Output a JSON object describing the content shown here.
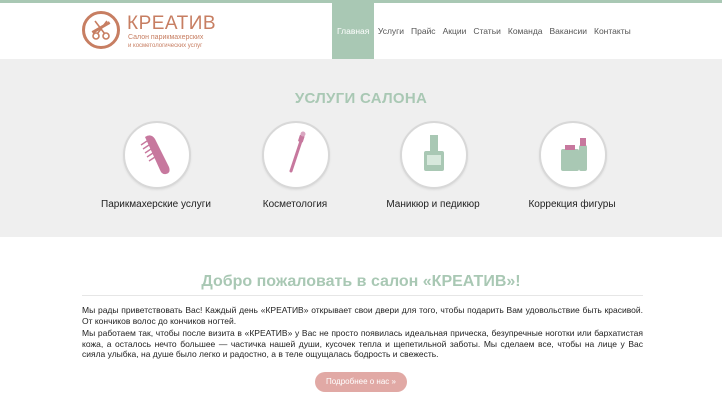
{
  "brand": {
    "title": "КРЕАТИВ",
    "subtitle_line1": "Салон парикмахерских",
    "subtitle_line2": "и косметологических услуг",
    "logo_icon": "scissors-comb-icon",
    "accent_color": "#c77e62"
  },
  "nav": {
    "items": [
      {
        "label": "Главная",
        "active": true
      },
      {
        "label": "Услуги"
      },
      {
        "label": "Прайс"
      },
      {
        "label": "Акции"
      },
      {
        "label": "Статьи"
      },
      {
        "label": "Команда"
      },
      {
        "label": "Вакансии"
      },
      {
        "label": "Контакты"
      }
    ]
  },
  "services": {
    "title": "УСЛУГИ САЛОНА",
    "items": [
      {
        "label": "Парикмахерские услуги",
        "icon": "comb-icon"
      },
      {
        "label": "Косметология",
        "icon": "brush-icon"
      },
      {
        "label": "Маникюр и педикюр",
        "icon": "nail-polish-icon"
      },
      {
        "label": "Коррекция фигуры",
        "icon": "bottles-icon"
      }
    ]
  },
  "welcome": {
    "title": "Добро пожаловать в салон «КРЕАТИВ»!",
    "paragraph1": "Мы рады приветствовать Вас! Каждый день «КРЕАТИВ» открывает свои двери для того, чтобы подарить Вам удовольствие быть красивой. От кончиков волос до кончиков ногтей.",
    "paragraph2": "Мы работаем так, чтобы после визита в «КРЕАТИВ» у Вас не просто появилась идеальная прическа, безупречные ноготки или бархатистая кожа, а осталось нечто большее — частичка нашей души, кусочек тепла и щепетильной заботы. Мы сделаем все, чтобы на лице у Вас сияла улыбка, на душе было легко и радостно, а в теле ощущалась бодрость и свежесть.",
    "more_button": "Подробнее о нас »"
  },
  "colors": {
    "green_accent": "#a9c8b4",
    "pink_button": "#e1a9a5",
    "icon_pink": "#c7789e",
    "band_bg": "#efefef"
  }
}
